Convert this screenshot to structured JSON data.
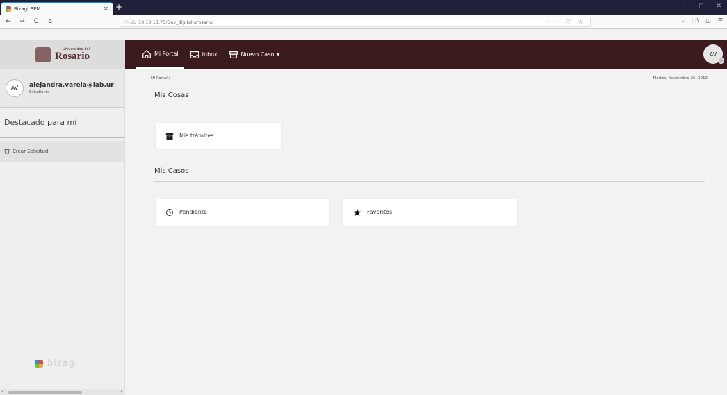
{
  "browser": {
    "tab_title": "Bizagi BPM",
    "tab_close": "×",
    "new_tab": "+",
    "window_controls": [
      "–",
      "◻",
      "✕"
    ],
    "nav_buttons": [
      "←",
      "→",
      "C",
      "⌂"
    ],
    "url": "10.10.10.75/Dev_digital.urosario/",
    "url_actions": "··· ♡ ☆",
    "tools": [
      "⤓",
      "|||\\",
      "◫",
      "☰"
    ]
  },
  "header": {
    "logo_small": "Universidad del",
    "logo_big": "Rosario",
    "nav": [
      {
        "label": "Mi Portal",
        "icon": "home-icon"
      },
      {
        "label": "Inbox",
        "icon": "inbox-icon"
      },
      {
        "label": "Nuevo Caso",
        "icon": "new-case-icon",
        "caret": "▾"
      }
    ],
    "avatar": "AV"
  },
  "sidebar": {
    "avatar": "AV",
    "email": "alejandra.varela@lab.ur",
    "role": "Estudiante",
    "highlight": "Destacado para mí",
    "create_request": "Crear Solicitud",
    "brand": "bizagi"
  },
  "main": {
    "breadcrumb": "Mi Portal /",
    "date": "Martes, Noviembre 26, 2019",
    "sections": [
      {
        "title": "Mis Cosas",
        "cards": [
          {
            "label": "Mis trámites",
            "icon": "archive-icon"
          }
        ]
      },
      {
        "title": "Mis Casos",
        "cards": [
          {
            "label": "Pendiente",
            "icon": "clock-icon"
          },
          {
            "label": "Favoritos",
            "icon": "star-icon"
          }
        ]
      }
    ]
  },
  "colors": {
    "header_bg": "#3b1b1e",
    "tab_accent": "#0a84ff",
    "page_bg": "#f2f2f2"
  }
}
